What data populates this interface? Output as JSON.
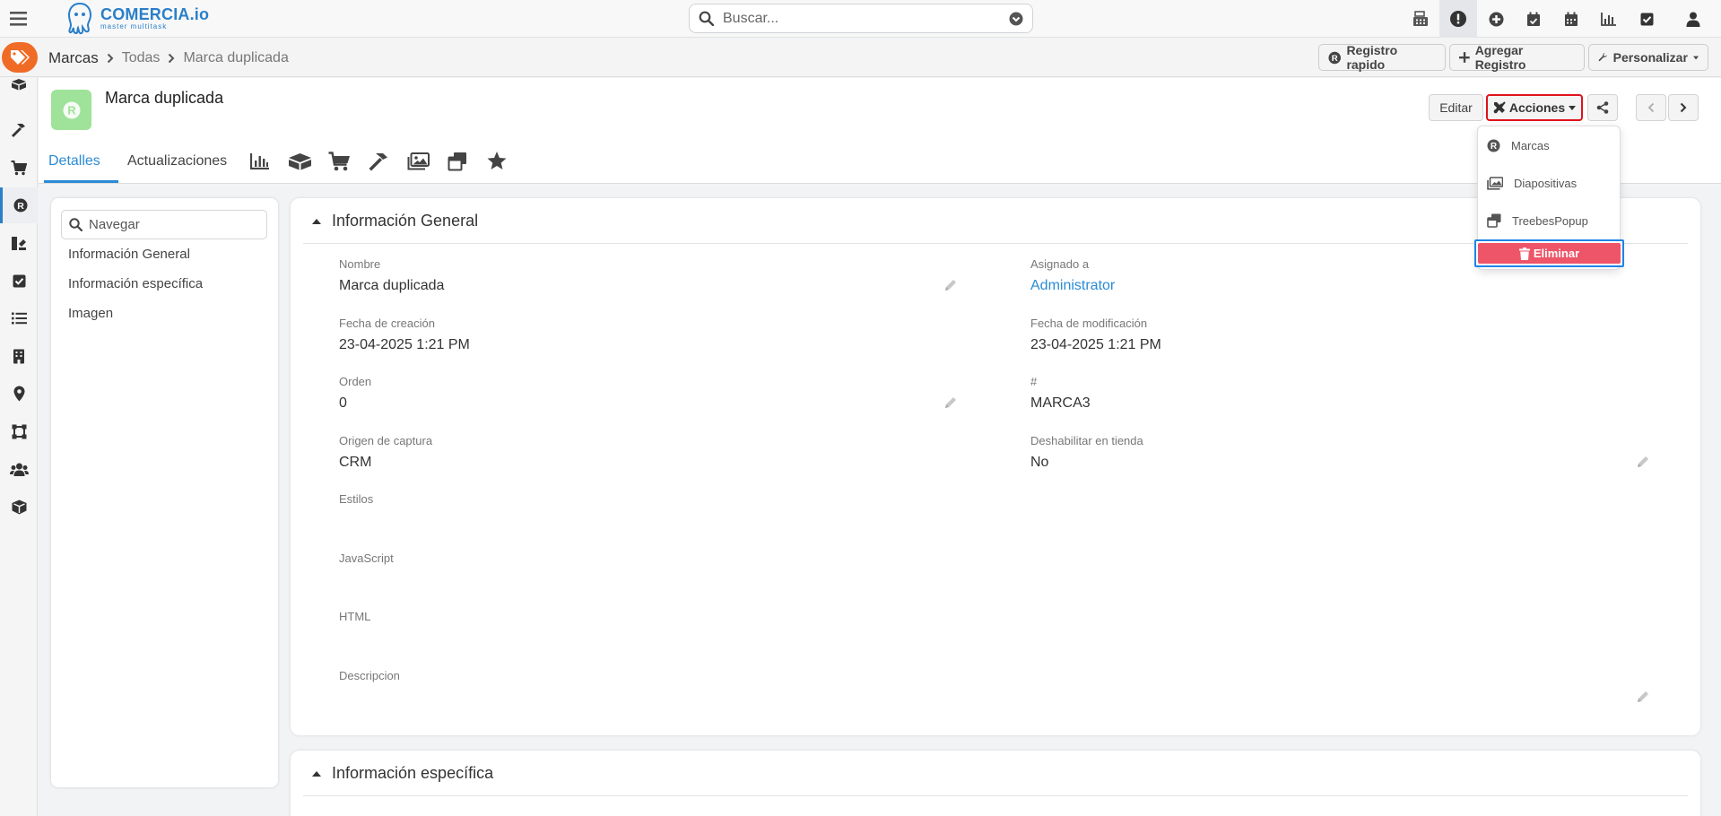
{
  "app": {
    "brand": "COMERCIA.io",
    "tagline": "master multitask"
  },
  "search": {
    "placeholder": "Buscar..."
  },
  "top_icons": [
    "calculator-icon",
    "alert-icon",
    "plus-circle-icon",
    "calendar-check-icon",
    "calendar-icon",
    "chart-icon",
    "checkbox-icon",
    "user-icon"
  ],
  "breadcrumb": {
    "module": "Marcas",
    "list": "Todas",
    "current": "Marca duplicada"
  },
  "header_buttons": {
    "quick": "Registro rapido",
    "add": "Agregar Registro",
    "customize": "Personalizar"
  },
  "record": {
    "avatar_letter": "R",
    "title": "Marca duplicada",
    "edit": "Editar",
    "actions": "Acciones"
  },
  "tabs": {
    "details": "Detalles",
    "updates": "Actualizaciones"
  },
  "dropdown": {
    "items": [
      "Marcas",
      "Diapositivas",
      "TreebesPopup"
    ],
    "delete": "Eliminar"
  },
  "nav": {
    "placeholder": "Navegar",
    "links": [
      "Información General",
      "Información específica",
      "Imagen"
    ]
  },
  "general": {
    "title": "Información General",
    "fields": {
      "nombre": {
        "label": "Nombre",
        "value": "Marca duplicada"
      },
      "asignado": {
        "label": "Asignado a",
        "value": "Administrator"
      },
      "creacion": {
        "label": "Fecha de creación",
        "value": "23-04-2025 1:21 PM"
      },
      "modificacion": {
        "label": "Fecha de modificación",
        "value": "23-04-2025 1:21 PM"
      },
      "orden": {
        "label": "Orden",
        "value": "0"
      },
      "numero": {
        "label": "#",
        "value": "MARCA3"
      },
      "origen": {
        "label": "Origen de captura",
        "value": "CRM"
      },
      "deshabilitar": {
        "label": "Deshabilitar en tienda",
        "value": "No"
      },
      "estilos": {
        "label": "Estilos",
        "value": ""
      },
      "javascript": {
        "label": "JavaScript",
        "value": ""
      },
      "html": {
        "label": "HTML",
        "value": ""
      },
      "descripcion": {
        "label": "Descripcion",
        "value": ""
      }
    }
  },
  "specific": {
    "title": "Información específica"
  },
  "colors": {
    "accent": "#2a8bd5",
    "brand_orange": "#f06b26",
    "delete_red": "#ee5568",
    "avatar_green": "#9fe29a"
  }
}
